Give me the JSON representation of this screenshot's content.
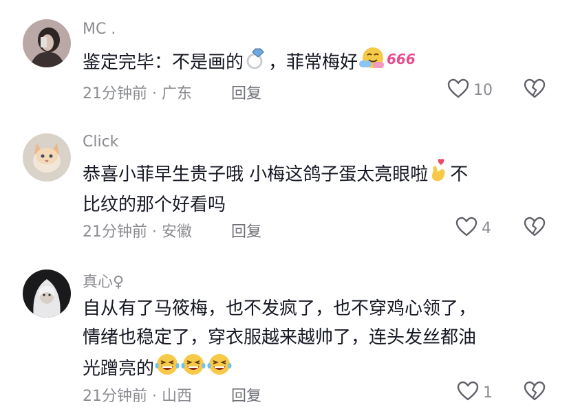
{
  "comments": [
    {
      "username": "MC .",
      "text_before": "鉴定完毕：不是画的",
      "text_after": "，菲常梅好",
      "emoji_ring": "ring-emoji",
      "emoji_hug": "hug-emoji",
      "emoji_666": "666-emoji",
      "meta": "21分钟前 · 广东",
      "reply": "回复",
      "likes": "10"
    },
    {
      "username": "Click",
      "text_before": "恭喜小菲早生贵子哦   小梅这鸽子蛋太亮眼啦",
      "emoji_finger_heart": "finger-heart-emoji",
      "text_after_line1": "不",
      "text_line2": "比纹的那个好看吗",
      "meta": "21分钟前 · 安徽",
      "reply": "回复",
      "likes": "4"
    },
    {
      "username": "真心♀",
      "text_line1": "自从有了马筱梅，也不发疯了，也不穿鸡心领了，",
      "text_line2": "情绪也稳定了，穿衣服越来越帅了，连头发丝都油",
      "text_line3": "光蹭亮的",
      "emoji_laugh": "laughing-emoji",
      "meta": "21分钟前 · 山西",
      "reply": "回复",
      "likes": "1"
    }
  ],
  "icons": {
    "like": "heart-outline-icon",
    "dislike": "broken-heart-icon"
  },
  "colors": {
    "text": "#161823",
    "meta": "#8a8b91",
    "icon": "#5f6068"
  }
}
